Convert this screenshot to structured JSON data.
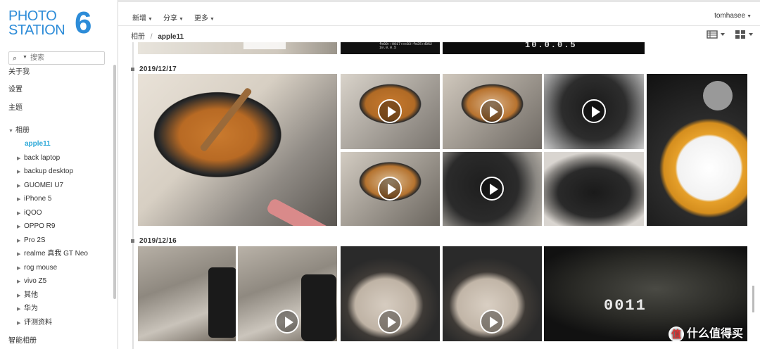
{
  "logo": {
    "line1": "PHOTO",
    "line2": "STATION",
    "version": "6"
  },
  "search": {
    "placeholder": "搜索"
  },
  "sidebar": {
    "top_items": [
      {
        "label": "关于我"
      },
      {
        "label": "设置"
      },
      {
        "label": "主题"
      }
    ],
    "albums_label": "相册",
    "albums": [
      {
        "label": "apple11",
        "active": true
      },
      {
        "label": "back laptop"
      },
      {
        "label": "backup desktop"
      },
      {
        "label": "GUOMEI U7"
      },
      {
        "label": "iPhone 5"
      },
      {
        "label": "iQOO"
      },
      {
        "label": "OPPO R9"
      },
      {
        "label": "Pro 2S"
      },
      {
        "label": "realme 真我 GT Neo"
      },
      {
        "label": "rog mouse"
      },
      {
        "label": "vivo Z5"
      },
      {
        "label": "其他"
      },
      {
        "label": "华为"
      },
      {
        "label": "评测资料"
      }
    ],
    "smart_label": "智能相册"
  },
  "toolbar": {
    "new": "新增",
    "share": "分享",
    "more": "更多",
    "user": "tomhasee"
  },
  "breadcrumb": {
    "root": "相册",
    "sep": "/",
    "current": "apple11"
  },
  "groups": [
    {
      "date": "2019/12/17"
    },
    {
      "date": "2019/12/16"
    }
  ],
  "top_strip": {
    "text1": "fe80::9017:cc83:fe25:d8%2",
    "text2": "10.0.0.5",
    "text3": "10.0.0.5"
  },
  "watermark": {
    "icon": "值",
    "text": "什么值得买"
  }
}
